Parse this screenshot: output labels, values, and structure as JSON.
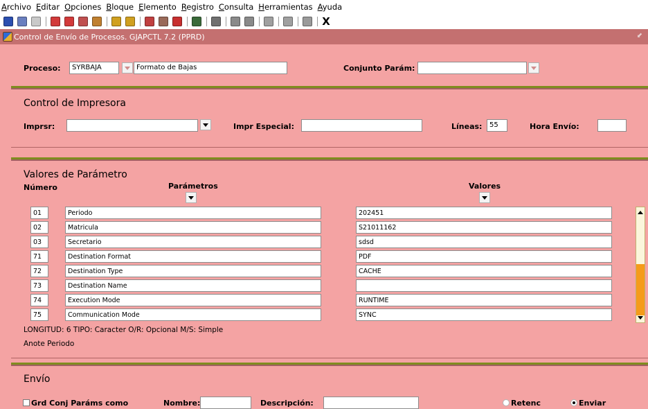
{
  "menu": {
    "items": [
      {
        "label": "Archivo",
        "key": "A",
        "rest": "rchivo"
      },
      {
        "label": "Editar",
        "key": "E",
        "rest": "ditar"
      },
      {
        "label": "Opciones",
        "key": "O",
        "rest": "pciones"
      },
      {
        "label": "Bloque",
        "key": "B",
        "rest": "loque"
      },
      {
        "label": "Elemento",
        "key": "E",
        "rest": "lemento"
      },
      {
        "label": "Registro",
        "key": "R",
        "rest": "egistro"
      },
      {
        "label": "Consulta",
        "key": "C",
        "rest": "onsulta"
      },
      {
        "label": "Herramientas",
        "key": "H",
        "rest": "erramientas"
      },
      {
        "label": "Ayuda",
        "key": "A",
        "rest": "yuda"
      }
    ]
  },
  "toolbar": {
    "exit_label": "X",
    "icons": [
      {
        "name": "save-icon",
        "color": "#2b4fb0"
      },
      {
        "name": "rollback-icon",
        "color": "#6a7fbf"
      },
      {
        "name": "document-icon",
        "color": "#c9c9c9"
      },
      {
        "sep": true
      },
      {
        "name": "prev-block-icon",
        "color": "#d23a3a"
      },
      {
        "name": "next-block-icon",
        "color": "#d23a3a"
      },
      {
        "name": "clear-block-icon",
        "color": "#c05050"
      },
      {
        "name": "clear-form-icon",
        "color": "#c08030"
      },
      {
        "sep": true
      },
      {
        "name": "enter-query-icon",
        "color": "#d0a020"
      },
      {
        "name": "execute-query-icon",
        "color": "#d0a020"
      },
      {
        "sep": true
      },
      {
        "name": "insert-record-icon",
        "color": "#c04040"
      },
      {
        "name": "delete-record-icon",
        "color": "#9a6a5a"
      },
      {
        "name": "remove-record-icon",
        "color": "#c83030"
      },
      {
        "sep": true
      },
      {
        "name": "print-icon",
        "color": "#3a6a3a"
      },
      {
        "sep": true
      },
      {
        "name": "print-setup-icon",
        "color": "#707070"
      },
      {
        "sep": true
      },
      {
        "name": "export-excel-icon",
        "color": "#8a8a8a"
      },
      {
        "name": "export-word-icon",
        "color": "#8a8a8a"
      },
      {
        "sep": true
      },
      {
        "name": "back-icon",
        "color": "#a0a0a0"
      },
      {
        "sep": true
      },
      {
        "name": "network-icon",
        "color": "#a0a0a0"
      },
      {
        "sep": true
      },
      {
        "name": "help-icon",
        "color": "#9a9a9a"
      }
    ]
  },
  "titlebar": {
    "title": "Control de Envío de Procesos. GJAPCTL 7.2 (PPRD)"
  },
  "header": {
    "proceso_label": "Proceso:",
    "proceso_value": "SYRBAJA",
    "proceso_desc": "Formato de Bajas",
    "conjunto_label": "Conjunto Parám:",
    "conjunto_value": ""
  },
  "printer": {
    "title": "Control de Impresora",
    "imprsr_label": "Imprsr:",
    "imprsr_value": "",
    "especial_label": "Impr Especial:",
    "especial_value": "",
    "lineas_label": "Líneas:",
    "lineas_value": "55",
    "hora_label": "Hora Envío:",
    "hora_value": ""
  },
  "params": {
    "title": "Valores de Parámetro",
    "col_numero": "Número",
    "col_parametros": "Parámetros",
    "col_valores": "Valores",
    "rows": [
      {
        "num": "01",
        "param": "Periodo",
        "value": "202451"
      },
      {
        "num": "02",
        "param": "Matricula",
        "value": "S21011162"
      },
      {
        "num": "03",
        "param": "Secretario",
        "value": "sdsd"
      },
      {
        "num": "71",
        "param": "Destination Format",
        "value": "PDF"
      },
      {
        "num": "72",
        "param": "Destination Type",
        "value": "CACHE"
      },
      {
        "num": "73",
        "param": "Destination Name",
        "value": ""
      },
      {
        "num": "74",
        "param": "Execution Mode",
        "value": "RUNTIME"
      },
      {
        "num": "75",
        "param": "Communication Mode",
        "value": "SYNC"
      }
    ],
    "info_line": "LONGITUD: 6 TIPO: Caracter O/R: Opcional M/S: Simple",
    "hint": "Anote Periodo"
  },
  "envio": {
    "title": "Envío",
    "grd_label": "Grd Conj Paráms como",
    "nombre_label": "Nombre:",
    "nombre_value": "",
    "descripcion_label": "Descripción:",
    "descripcion_value": "",
    "retenc_label": "Retenc",
    "enviar_label": "Enviar"
  },
  "colors": {
    "background": "#f4a3a3",
    "titlebar": "#c47070",
    "separator": "#7f8c1f",
    "scroll_thumb": "#f59b1a"
  }
}
